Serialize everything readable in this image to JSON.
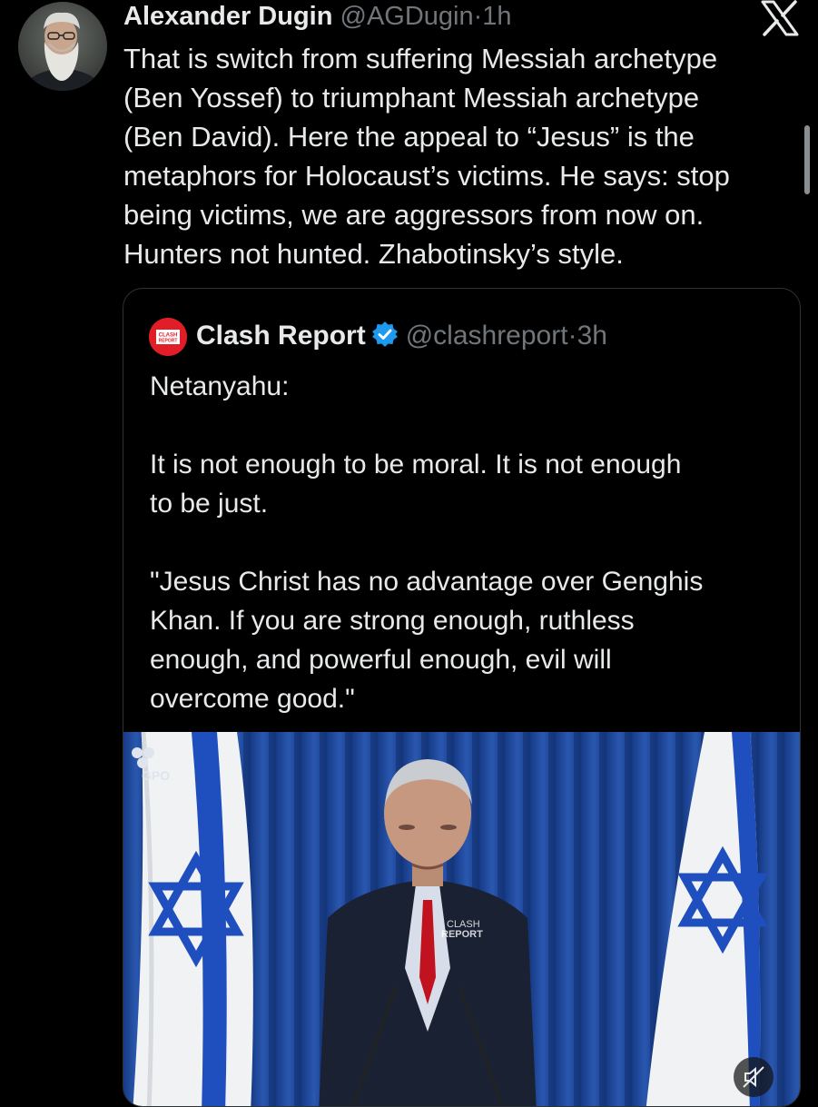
{
  "tweet": {
    "author_name": "Alexander Dugin",
    "author_handle": "@AGDugin",
    "separator": "·",
    "time": "1h",
    "text": "That is switch from suffering Messiah archetype\n(Ben Yossef) to triumphant Messiah archetype\n(Ben David). Here the appeal to “Jesus” is the\nmetaphors for Holocaust’s victims. He says: stop\nbeing victims, we are aggressors from now on.\nHunters not hunted. Zhabotinsky’s style."
  },
  "quoted_tweet": {
    "author_name": "Clash Report",
    "author_handle": "@clashreport",
    "separator": "·",
    "time": "3h",
    "avatar_text_top": "CLASH",
    "avatar_text_bottom": "REPORT",
    "text": "Netanyahu:\n\nIt is not enough to be moral. It is not enough\nto be just.\n\n\"Jesus Christ has no advantage over Genghis\nKhan. If you are strong enough, ruthless\nenough, and powerful enough, evil will\novercome good.\"",
    "media": {
      "corner_logo": "GPO",
      "watermark_top": "CLASH",
      "watermark_bottom": "REPORT"
    }
  },
  "icons": {
    "app_logo": "x-logo-icon",
    "verified": "verified-badge-icon",
    "mute": "muted-speaker-icon"
  },
  "colors": {
    "background": "#000000",
    "text_primary": "#e7e9ea",
    "text_secondary": "#71767b",
    "verified_blue": "#1d9bf0",
    "brand_red": "#e11d27",
    "card_border": "#2f3336"
  }
}
